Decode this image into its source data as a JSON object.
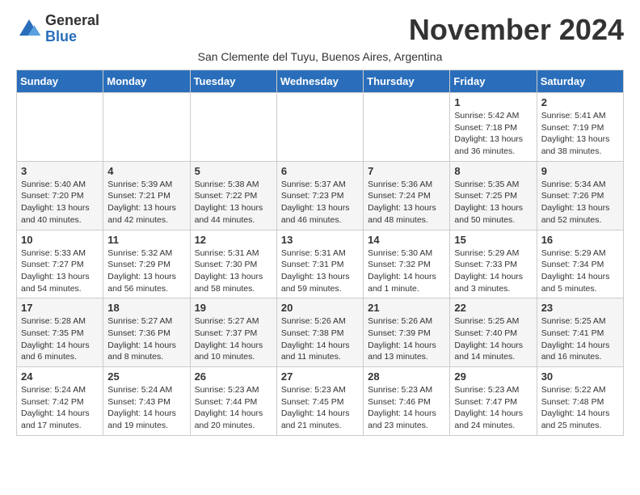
{
  "header": {
    "logo_general": "General",
    "logo_blue": "Blue",
    "month_title": "November 2024",
    "subtitle": "San Clemente del Tuyu, Buenos Aires, Argentina"
  },
  "weekdays": [
    "Sunday",
    "Monday",
    "Tuesday",
    "Wednesday",
    "Thursday",
    "Friday",
    "Saturday"
  ],
  "weeks": [
    [
      {
        "day": "",
        "text": ""
      },
      {
        "day": "",
        "text": ""
      },
      {
        "day": "",
        "text": ""
      },
      {
        "day": "",
        "text": ""
      },
      {
        "day": "",
        "text": ""
      },
      {
        "day": "1",
        "text": "Sunrise: 5:42 AM\nSunset: 7:18 PM\nDaylight: 13 hours\nand 36 minutes."
      },
      {
        "day": "2",
        "text": "Sunrise: 5:41 AM\nSunset: 7:19 PM\nDaylight: 13 hours\nand 38 minutes."
      }
    ],
    [
      {
        "day": "3",
        "text": "Sunrise: 5:40 AM\nSunset: 7:20 PM\nDaylight: 13 hours\nand 40 minutes."
      },
      {
        "day": "4",
        "text": "Sunrise: 5:39 AM\nSunset: 7:21 PM\nDaylight: 13 hours\nand 42 minutes."
      },
      {
        "day": "5",
        "text": "Sunrise: 5:38 AM\nSunset: 7:22 PM\nDaylight: 13 hours\nand 44 minutes."
      },
      {
        "day": "6",
        "text": "Sunrise: 5:37 AM\nSunset: 7:23 PM\nDaylight: 13 hours\nand 46 minutes."
      },
      {
        "day": "7",
        "text": "Sunrise: 5:36 AM\nSunset: 7:24 PM\nDaylight: 13 hours\nand 48 minutes."
      },
      {
        "day": "8",
        "text": "Sunrise: 5:35 AM\nSunset: 7:25 PM\nDaylight: 13 hours\nand 50 minutes."
      },
      {
        "day": "9",
        "text": "Sunrise: 5:34 AM\nSunset: 7:26 PM\nDaylight: 13 hours\nand 52 minutes."
      }
    ],
    [
      {
        "day": "10",
        "text": "Sunrise: 5:33 AM\nSunset: 7:27 PM\nDaylight: 13 hours\nand 54 minutes."
      },
      {
        "day": "11",
        "text": "Sunrise: 5:32 AM\nSunset: 7:29 PM\nDaylight: 13 hours\nand 56 minutes."
      },
      {
        "day": "12",
        "text": "Sunrise: 5:31 AM\nSunset: 7:30 PM\nDaylight: 13 hours\nand 58 minutes."
      },
      {
        "day": "13",
        "text": "Sunrise: 5:31 AM\nSunset: 7:31 PM\nDaylight: 13 hours\nand 59 minutes."
      },
      {
        "day": "14",
        "text": "Sunrise: 5:30 AM\nSunset: 7:32 PM\nDaylight: 14 hours\nand 1 minute."
      },
      {
        "day": "15",
        "text": "Sunrise: 5:29 AM\nSunset: 7:33 PM\nDaylight: 14 hours\nand 3 minutes."
      },
      {
        "day": "16",
        "text": "Sunrise: 5:29 AM\nSunset: 7:34 PM\nDaylight: 14 hours\nand 5 minutes."
      }
    ],
    [
      {
        "day": "17",
        "text": "Sunrise: 5:28 AM\nSunset: 7:35 PM\nDaylight: 14 hours\nand 6 minutes."
      },
      {
        "day": "18",
        "text": "Sunrise: 5:27 AM\nSunset: 7:36 PM\nDaylight: 14 hours\nand 8 minutes."
      },
      {
        "day": "19",
        "text": "Sunrise: 5:27 AM\nSunset: 7:37 PM\nDaylight: 14 hours\nand 10 minutes."
      },
      {
        "day": "20",
        "text": "Sunrise: 5:26 AM\nSunset: 7:38 PM\nDaylight: 14 hours\nand 11 minutes."
      },
      {
        "day": "21",
        "text": "Sunrise: 5:26 AM\nSunset: 7:39 PM\nDaylight: 14 hours\nand 13 minutes."
      },
      {
        "day": "22",
        "text": "Sunrise: 5:25 AM\nSunset: 7:40 PM\nDaylight: 14 hours\nand 14 minutes."
      },
      {
        "day": "23",
        "text": "Sunrise: 5:25 AM\nSunset: 7:41 PM\nDaylight: 14 hours\nand 16 minutes."
      }
    ],
    [
      {
        "day": "24",
        "text": "Sunrise: 5:24 AM\nSunset: 7:42 PM\nDaylight: 14 hours\nand 17 minutes."
      },
      {
        "day": "25",
        "text": "Sunrise: 5:24 AM\nSunset: 7:43 PM\nDaylight: 14 hours\nand 19 minutes."
      },
      {
        "day": "26",
        "text": "Sunrise: 5:23 AM\nSunset: 7:44 PM\nDaylight: 14 hours\nand 20 minutes."
      },
      {
        "day": "27",
        "text": "Sunrise: 5:23 AM\nSunset: 7:45 PM\nDaylight: 14 hours\nand 21 minutes."
      },
      {
        "day": "28",
        "text": "Sunrise: 5:23 AM\nSunset: 7:46 PM\nDaylight: 14 hours\nand 23 minutes."
      },
      {
        "day": "29",
        "text": "Sunrise: 5:23 AM\nSunset: 7:47 PM\nDaylight: 14 hours\nand 24 minutes."
      },
      {
        "day": "30",
        "text": "Sunrise: 5:22 AM\nSunset: 7:48 PM\nDaylight: 14 hours\nand 25 minutes."
      }
    ]
  ]
}
